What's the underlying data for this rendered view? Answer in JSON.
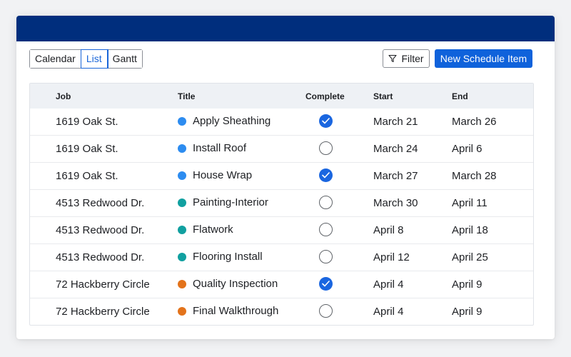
{
  "toolbar": {
    "views": [
      "Calendar",
      "List",
      "Gantt"
    ],
    "active_view": "List",
    "filter_label": "Filter",
    "new_item_label": "New Schedule Item"
  },
  "table": {
    "columns": {
      "job": "Job",
      "title": "Title",
      "complete": "Complete",
      "start": "Start",
      "end": "End"
    },
    "status_colors": {
      "blue": "#2d8cf0",
      "teal": "#11a0a0",
      "orange": "#e3731b"
    },
    "rows": [
      {
        "job": "1619 Oak St.",
        "title": "Apply Sheathing",
        "color": "#2d8cf0",
        "complete": true,
        "start": "March 21",
        "end": "March 26"
      },
      {
        "job": "1619 Oak St.",
        "title": "Install Roof",
        "color": "#2d8cf0",
        "complete": false,
        "start": "March 24",
        "end": "April 6"
      },
      {
        "job": "1619 Oak St.",
        "title": "House Wrap",
        "color": "#2d8cf0",
        "complete": true,
        "start": "March 27",
        "end": "March 28"
      },
      {
        "job": "4513 Redwood Dr.",
        "title": "Painting-Interior",
        "color": "#11a0a0",
        "complete": false,
        "start": "March 30",
        "end": "April 11"
      },
      {
        "job": "4513 Redwood Dr.",
        "title": "Flatwork",
        "color": "#11a0a0",
        "complete": false,
        "start": "April 8",
        "end": "April 18"
      },
      {
        "job": "4513 Redwood Dr.",
        "title": "Flooring Install",
        "color": "#11a0a0",
        "complete": false,
        "start": "April 12",
        "end": "April 25"
      },
      {
        "job": "72 Hackberry Circle",
        "title": "Quality Inspection",
        "color": "#e3731b",
        "complete": true,
        "start": "April 4",
        "end": "April 9"
      },
      {
        "job": "72 Hackberry Circle",
        "title": "Final Walkthrough",
        "color": "#e3731b",
        "complete": false,
        "start": "April 4",
        "end": "April 9"
      }
    ]
  }
}
